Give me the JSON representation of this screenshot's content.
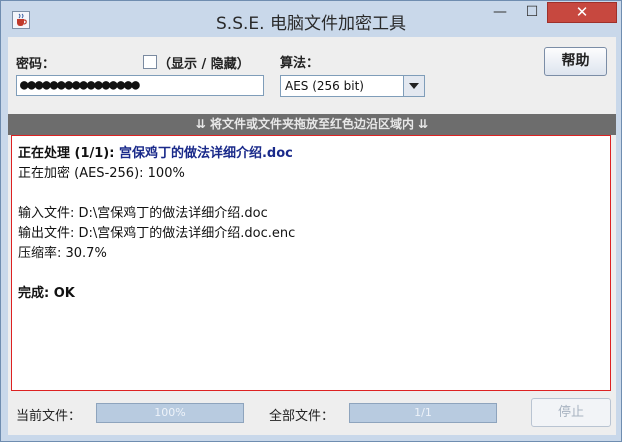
{
  "window": {
    "title": "S.S.E. 电脑文件加密工具",
    "minimize_glyph": "—",
    "maximize_glyph": "☐",
    "close_glyph": "✕",
    "app_icon": "java-cup-icon"
  },
  "form": {
    "password_label": "密码：",
    "show_hide_label": "（显示 / 隐藏）",
    "show_password_checked": false,
    "password_value": "●●●●●●●●●●●●●●●●",
    "algorithm_label": "算法：",
    "algorithm_selected": "AES (256 bit)",
    "help_label": "帮助"
  },
  "dropzone": {
    "text": "⇊ 将文件或文件夹拖放至红色边沿区域内 ⇊"
  },
  "log": {
    "processing_prefix": "正在处理 (1/1): ",
    "processing_file": "宫保鸡丁的做法详细介绍.doc",
    "encrypting": "正在加密 (AES-256): 100%",
    "input_file": "输入文件: D:\\宫保鸡丁的做法详细介绍.doc",
    "output_file": "输出文件: D:\\宫保鸡丁的做法详细介绍.doc.enc",
    "compression": "压缩率: 30.7%",
    "done": "完成: OK"
  },
  "status": {
    "current_file_label": "当前文件：",
    "current_progress_text": "100%",
    "current_progress_fraction": 1.0,
    "all_files_label": "全部文件：",
    "all_progress_text": "1/1",
    "all_progress_fraction": 1.0,
    "stop_label": "停止"
  },
  "colors": {
    "dropzone_bar": "#6d6d6d",
    "log_border": "#dd2222",
    "close_button": "#c7483f",
    "filename_text": "#1a2a8a"
  }
}
